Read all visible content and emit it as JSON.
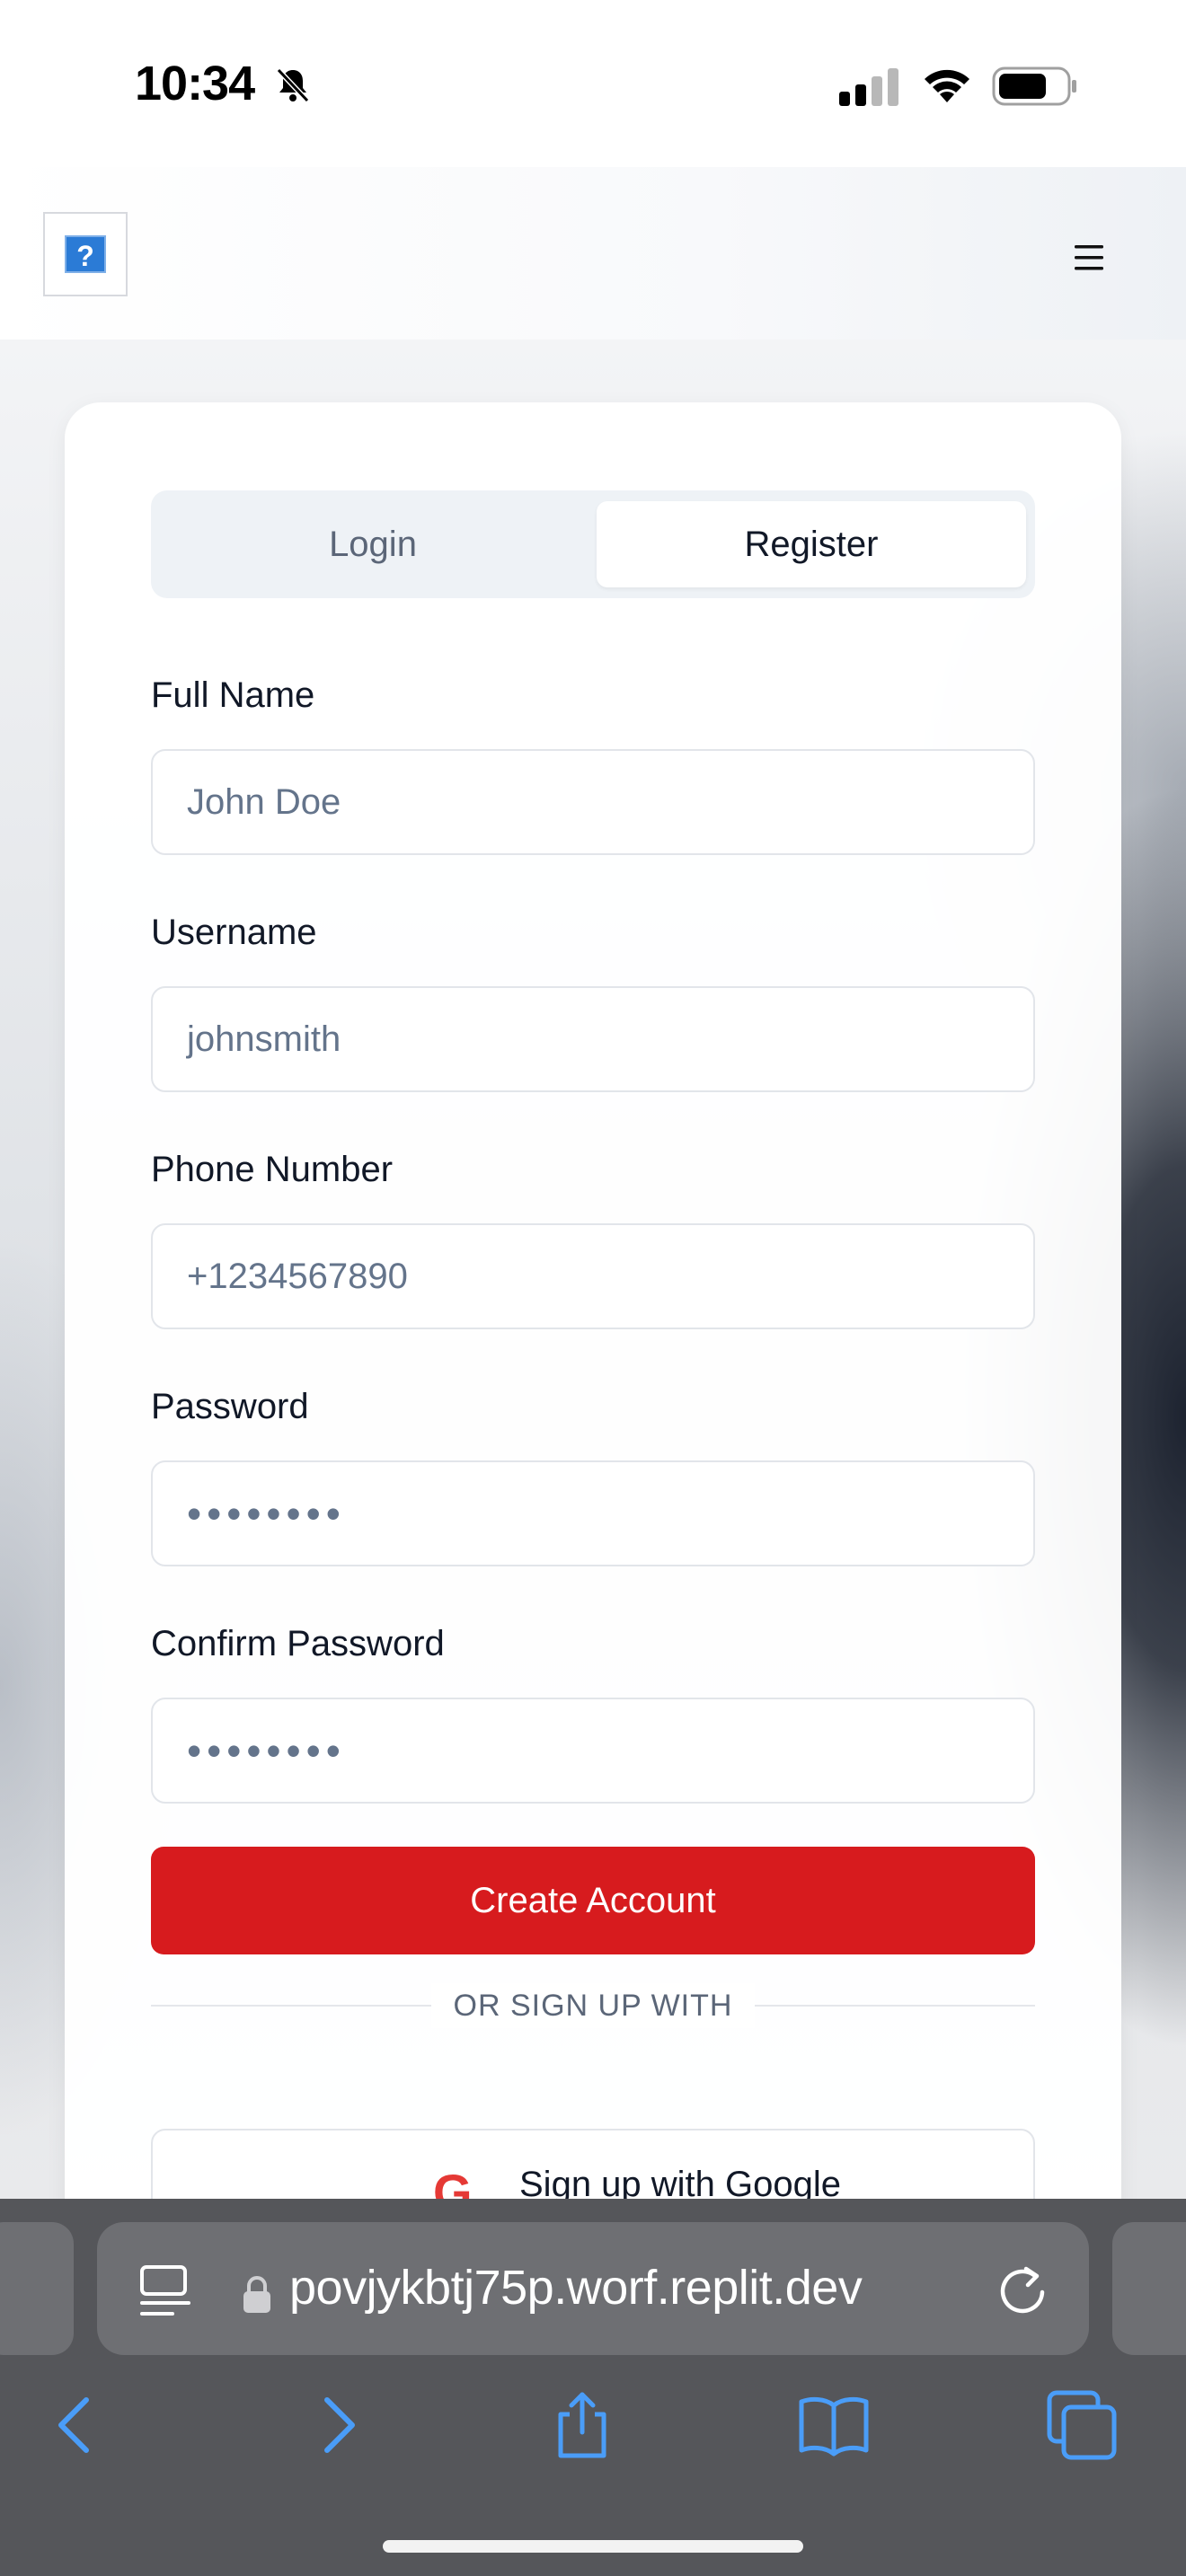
{
  "status_bar": {
    "time": "10:34"
  },
  "header": {
    "logo_alt": "?"
  },
  "auth": {
    "tabs": {
      "login": "Login",
      "register": "Register"
    },
    "fields": {
      "full_name": {
        "label": "Full Name",
        "placeholder": "John Doe"
      },
      "username": {
        "label": "Username",
        "placeholder": "johnsmith"
      },
      "phone": {
        "label": "Phone Number",
        "placeholder": "+1234567890"
      },
      "password": {
        "label": "Password",
        "placeholder": "••••••••"
      },
      "confirm_password": {
        "label": "Confirm Password",
        "placeholder": "••••••••"
      }
    },
    "submit_label": "Create Account",
    "divider_text": "OR SIGN UP WITH",
    "google_label": "Sign up with Google",
    "google_glyph": "G"
  },
  "browser": {
    "url": "povjykbtj75p.worf.replit.dev"
  },
  "colors": {
    "primary": "#d71b1e",
    "browser_bar": "#55565a",
    "accent_blue": "#4a9df8"
  }
}
